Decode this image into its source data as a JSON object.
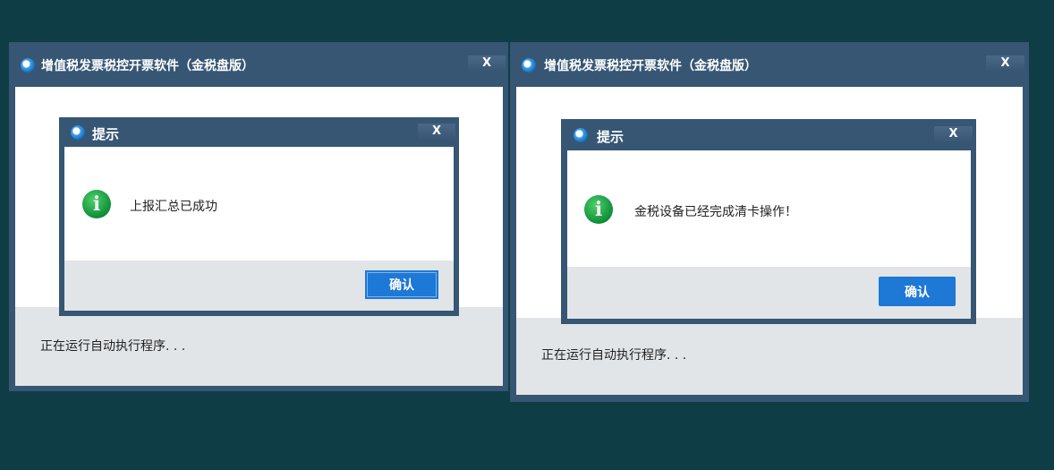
{
  "windows": [
    {
      "title": "增值税发票税控开票软件（金税盘版）",
      "close": "X",
      "status": "正在运行自动执行程序. . .",
      "dialog": {
        "title": "提示",
        "close": "X",
        "message": "上报汇总已成功",
        "confirm": "确认"
      }
    },
    {
      "title": "增值税发票税控开票软件（金税盘版）",
      "close": "X",
      "status": "正在运行自动执行程序. . .",
      "dialog": {
        "title": "提示",
        "close": "X",
        "message": "金税设备已经完成清卡操作！",
        "confirm": "确认"
      }
    }
  ],
  "icons": {
    "app": "app-logo-icon",
    "info": "info-icon"
  }
}
